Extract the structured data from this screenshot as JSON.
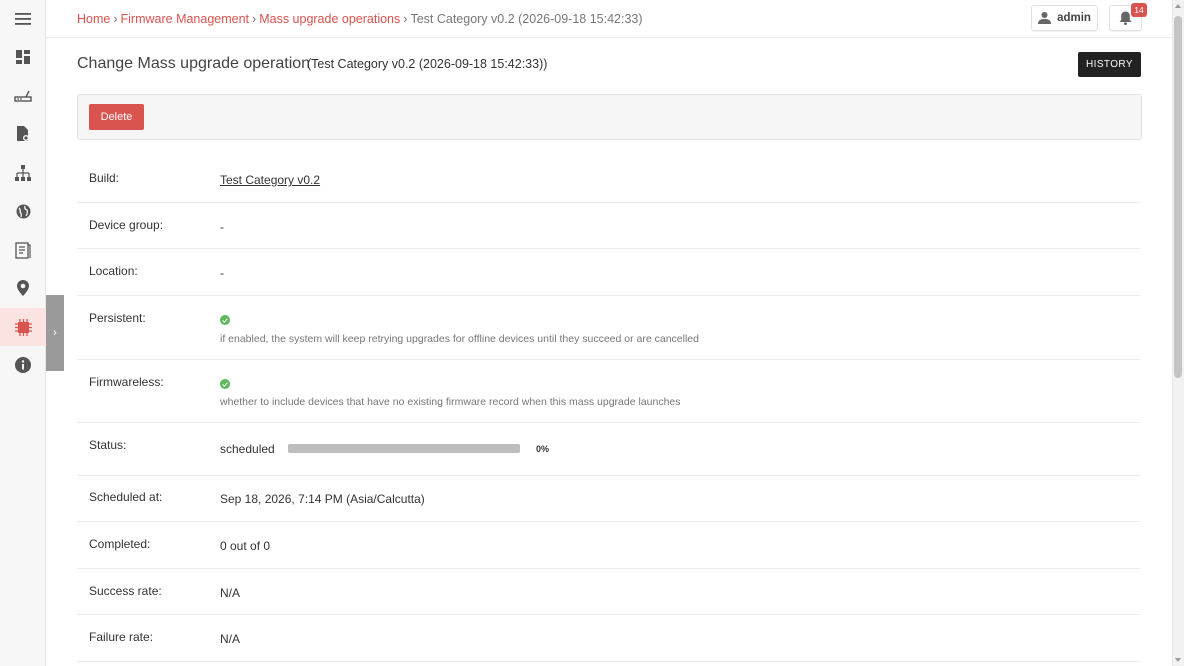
{
  "breadcrumb": {
    "items": [
      "Home",
      "Firmware Management",
      "Mass upgrade operations"
    ],
    "current": "Test Category v0.2 (2026-09-18 15:42:33)",
    "separator": "›"
  },
  "header": {
    "user_label": "admin",
    "notification_count": "14"
  },
  "page": {
    "title": "Change Mass upgrade operation",
    "subtitle": "(Test Category v0.2 (2026-09-18 15:42:33))",
    "history_label": "HISTORY",
    "delete_label": "Delete"
  },
  "fields": {
    "build": {
      "label": "Build:",
      "value": "Test Category v0.2"
    },
    "device_group": {
      "label": "Device group:",
      "value": "-"
    },
    "location": {
      "label": "Location:",
      "value": "-"
    },
    "persistent": {
      "label": "Persistent:",
      "help": "if enabled, the system will keep retrying upgrades for offline devices until they succeed or are cancelled"
    },
    "firmwareless": {
      "label": "Firmwareless:",
      "help": "whether to include devices that have no existing firmware record when this mass upgrade launches"
    },
    "status": {
      "label": "Status:",
      "value": "scheduled",
      "progress_percent": 0,
      "progress_text": "0%"
    },
    "scheduled_at": {
      "label": "Scheduled at:",
      "value": "Sep 18, 2026, 7:14 PM (Asia/Calcutta)"
    },
    "completed": {
      "label": "Completed:",
      "value": "0 out of 0"
    },
    "success_rate": {
      "label": "Success rate:",
      "value": "N/A"
    },
    "failure_rate": {
      "label": "Failure rate:",
      "value": "N/A"
    }
  },
  "colors": {
    "accent": "#d9534f",
    "success": "#5cb85c",
    "dark_button": "#222222"
  }
}
